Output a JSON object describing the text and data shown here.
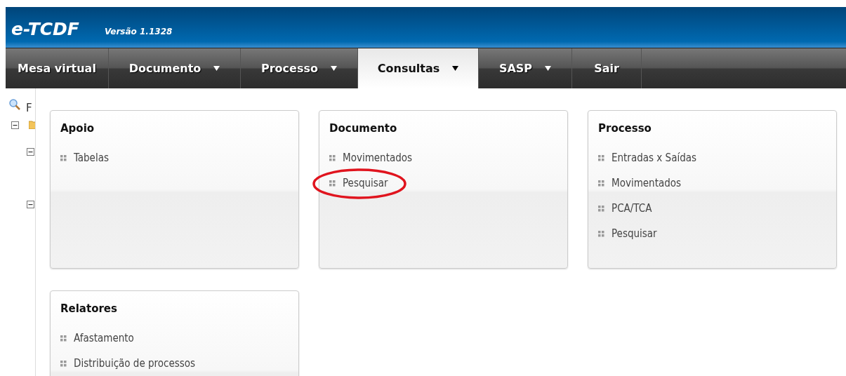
{
  "header": {
    "title": "e-TCDF",
    "version": "Versão 1.1328"
  },
  "nav": [
    {
      "label": "Mesa virtual",
      "dropdown": false,
      "selected": false
    },
    {
      "label": "Documento",
      "dropdown": true,
      "selected": false
    },
    {
      "label": "Processo",
      "dropdown": true,
      "selected": false
    },
    {
      "label": "Consultas",
      "dropdown": true,
      "selected": true
    },
    {
      "label": "SASP",
      "dropdown": true,
      "selected": false
    },
    {
      "label": "Sair",
      "dropdown": false,
      "selected": false
    }
  ],
  "sidebar": {
    "search_label": "F"
  },
  "cards": [
    {
      "title": "Apoio",
      "items": [
        {
          "label": "Tabelas",
          "circled": false
        }
      ]
    },
    {
      "title": "Documento",
      "items": [
        {
          "label": "Movimentados",
          "circled": false
        },
        {
          "label": "Pesquisar",
          "circled": true
        }
      ]
    },
    {
      "title": "Processo",
      "items": [
        {
          "label": "Entradas x Saídas",
          "circled": false
        },
        {
          "label": "Movimentados",
          "circled": false
        },
        {
          "label": "PCA/TCA",
          "circled": false
        },
        {
          "label": "Pesquisar",
          "circled": false
        }
      ]
    },
    {
      "title": "Relatores",
      "items": [
        {
          "label": "Afastamento",
          "circled": false
        },
        {
          "label": "Distribuição de processos",
          "circled": false
        }
      ]
    }
  ]
}
